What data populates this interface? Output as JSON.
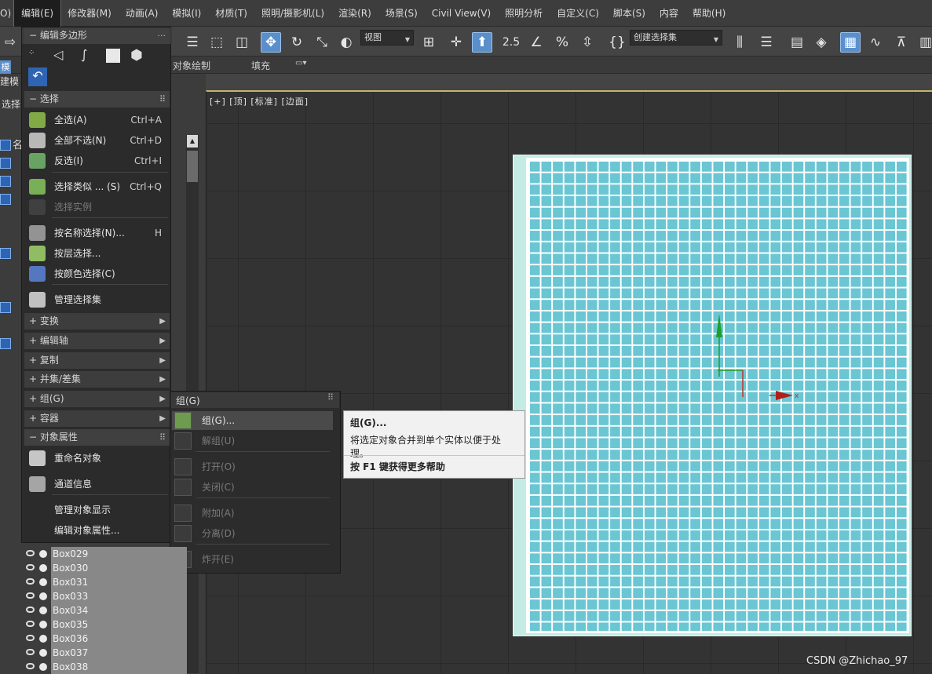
{
  "menubar": {
    "items": [
      "O)",
      "编辑(E)",
      "修改器(M)",
      "动画(A)",
      "模拟(I)",
      "材质(T)",
      "照明/摄影机(L)",
      "渲染(R)",
      "场景(S)",
      "Civil View(V)",
      "照明分析",
      "自定义(C)",
      "脚本(S)",
      "内容",
      "帮助(H)"
    ],
    "active_index": 1
  },
  "toolbar": {
    "view_dropdown": "视图",
    "selset_dropdown": "创建选择集",
    "snap_label": "2.5"
  },
  "ribbon": {
    "obj_paint": "对象绘制",
    "fill": "填充"
  },
  "left_panel": {
    "tab1": "模",
    "tab2": "建模",
    "select": "选择",
    "name_col": "名"
  },
  "edit_menu": {
    "sec_edit_poly": "编辑多边形",
    "sec_select": "选择",
    "select_items": [
      {
        "label": "全选(A)",
        "shortcut": "Ctrl+A",
        "icon": "select-all-icon",
        "color": "#8bb84a"
      },
      {
        "label": "全部不选(N)",
        "shortcut": "Ctrl+D",
        "icon": "select-none-icon",
        "color": "#c8c8c8"
      },
      {
        "label": "反选(I)",
        "shortcut": "Ctrl+I",
        "icon": "select-invert-icon",
        "color": "#6fb06a"
      },
      {
        "label": "选择类似 ... (S)",
        "shortcut": "Ctrl+Q",
        "icon": "select-similar-icon",
        "color": "#7fbf5a"
      },
      {
        "label": "选择实例",
        "shortcut": "",
        "icon": "select-instance-icon",
        "color": "#555",
        "disabled": true
      },
      {
        "label": "按名称选择(N)...",
        "shortcut": "H",
        "icon": "select-by-name-icon",
        "color": "#9e9e9e"
      },
      {
        "label": "按层选择...",
        "shortcut": "",
        "icon": "select-by-layer-icon",
        "color": "#9bcc6a"
      },
      {
        "label": "按颜色选择(C)",
        "shortcut": "",
        "icon": "select-by-color-icon",
        "color": "#5a7fd0"
      },
      {
        "label": "管理选择集",
        "shortcut": "",
        "icon": "manage-sets-icon",
        "color": "#d0d0d0"
      }
    ],
    "collapsed_sections": [
      "变换",
      "编辑轴",
      "复制",
      "并集/差集",
      "组(G)",
      "容器"
    ],
    "sec_obj_props": "对象属性",
    "prop_items": [
      {
        "label": "重命名对象",
        "icon": "rename-icon"
      },
      {
        "label": "通道信息",
        "icon": "channel-info-icon"
      },
      {
        "label": "管理对象显示",
        "icon": ""
      },
      {
        "label": "编辑对象属性...",
        "icon": ""
      }
    ]
  },
  "group_submenu": {
    "title": "组(G)",
    "items": [
      {
        "label": "组(G)...",
        "disabled": false,
        "highlighted": true
      },
      {
        "label": "解组(U)",
        "disabled": true
      },
      {
        "label": "打开(O)",
        "disabled": true
      },
      {
        "label": "关闭(C)",
        "disabled": true
      },
      {
        "label": "附加(A)",
        "disabled": true
      },
      {
        "label": "分离(D)",
        "disabled": true
      },
      {
        "label": "炸开(E)",
        "disabled": true
      }
    ]
  },
  "tooltip": {
    "title": "组(G)...",
    "desc": "将选定对象合并到单个实体以便于处理。",
    "help": "按 F1 键获得更多帮助"
  },
  "viewport": {
    "label": "[+] [顶] [标准] [边面]"
  },
  "objects": [
    "Box029",
    "Box030",
    "Box031",
    "Box033",
    "Box034",
    "Box035",
    "Box036",
    "Box037",
    "Box038"
  ],
  "watermark": "CSDN @Zhichao_97",
  "colors": {
    "accent": "#5b8fcb",
    "tile": "#6ac6d3",
    "viewport_border": "#c9b073"
  }
}
